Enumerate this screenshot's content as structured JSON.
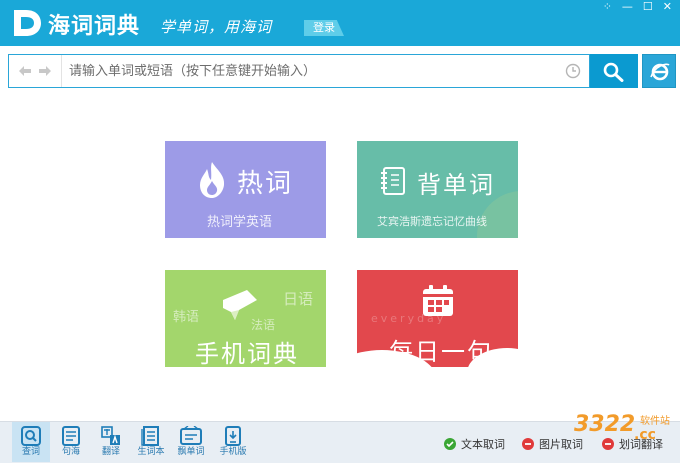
{
  "title_bar": {
    "logo_letter": "D",
    "app_name": "海词词典",
    "slogan": "学单词，用海词",
    "login_label": "登录",
    "window_controls": [
      "⁘",
      "—",
      "☐",
      "✕"
    ]
  },
  "search": {
    "placeholder": "请输入单词或短语（按下任意键开始输入）",
    "value": "",
    "back_icon": "arrow-left-icon",
    "forward_icon": "arrow-right-icon",
    "history_icon": "clock-icon",
    "search_icon": "magnifier-icon",
    "browser_icon": "ie-icon"
  },
  "tiles": {
    "hot": {
      "title": "热词",
      "subtitle": "热词学英语",
      "color": "#9d9be7",
      "icon": "flame-icon"
    },
    "vocab": {
      "title": "背单词",
      "subtitle": "艾宾浩斯遗忘记忆曲线",
      "color": "#67bda8",
      "icon": "notebook-icon"
    },
    "mobile": {
      "title": "手机词典",
      "langs": [
        "日语",
        "韩语",
        "法语"
      ],
      "color": "#a3d66c",
      "icon": "chat-icon"
    },
    "daily": {
      "title": "每日一句",
      "background_text": "everyday",
      "color": "#e2484d",
      "icon": "calendar-icon"
    }
  },
  "toolbar": {
    "items": [
      {
        "label": "查词",
        "icon": "lookup-icon",
        "active": true
      },
      {
        "label": "句海",
        "icon": "sentence-icon",
        "active": false
      },
      {
        "label": "翻译",
        "icon": "translate-icon",
        "active": false
      },
      {
        "label": "生词本",
        "icon": "wordbook-icon",
        "active": false
      },
      {
        "label": "飘单词",
        "icon": "floating-word-icon",
        "active": false
      },
      {
        "label": "手机版",
        "icon": "mobile-icon",
        "active": false
      }
    ],
    "options": [
      {
        "label": "文本取词",
        "state": "on",
        "color": "#3aa635"
      },
      {
        "label": "图片取词",
        "state": "off",
        "color": "#e03a3a"
      },
      {
        "label": "划词翻译",
        "state": "off",
        "color": "#e03a3a"
      }
    ]
  },
  "watermark": {
    "main": "3322",
    "suffix": ".cc",
    "sub": "软件站"
  }
}
